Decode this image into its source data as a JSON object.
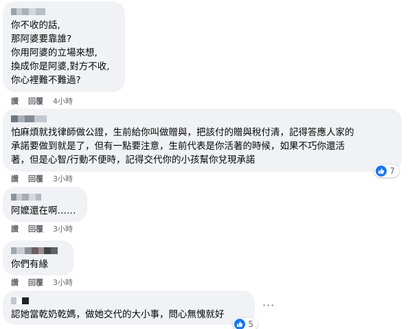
{
  "comments": [
    {
      "text": "你不收的話,\n那阿婆要靠誰?\n你用阿婆的立場來想,\n換成你是阿婆,對方不收,\n你心裡難不難過?",
      "like_label": "讚",
      "reply_label": "回覆",
      "time": "4小時"
    },
    {
      "text": "怕麻煩就找律師做公證，生前給你叫做贈與，把該付的贈與稅付清，記得答應人家的\n承諾要做到就是了，但有一點要注意，生前代表是你活著的時候，如果不巧你還活\n著，但是心智/行動不便時，記得交代你的小孩幫你兌現承諾",
      "like_label": "讚",
      "reply_label": "回覆",
      "time": "3小時",
      "reaction_count": "7"
    },
    {
      "text": "阿嬤還在啊……",
      "like_label": "讚",
      "reply_label": "回覆",
      "time": "3小時"
    },
    {
      "text": "你們有緣",
      "like_label": "讚",
      "reply_label": "回覆",
      "time": "3小時"
    },
    {
      "text": "認她當乾奶乾媽，做她交代的大小事，問心無愧就好",
      "reaction_count": "5",
      "more_label": "···"
    }
  ],
  "colors": {
    "bubble": "#f0f2f5",
    "meta_text": "#65676b",
    "like_blue": "#1877f2"
  },
  "icons": {
    "reaction": "like-thumb-icon",
    "more": "more-options-icon"
  }
}
